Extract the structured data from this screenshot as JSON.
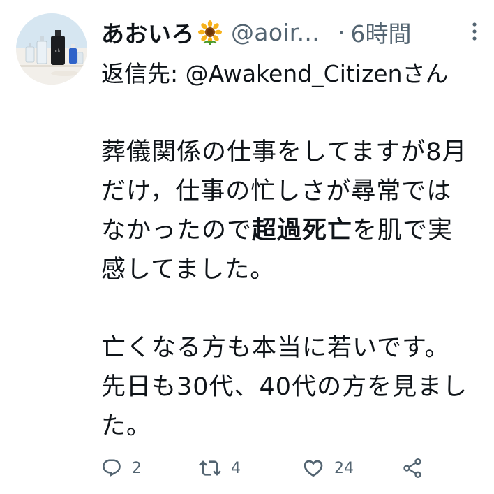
{
  "tweet": {
    "display_name": "あおいろ",
    "handle": "@aoir...",
    "separator": "·",
    "time": "6時間",
    "reply_prefix": "返信先: ",
    "reply_mention": "@Awakend_Citizenさん",
    "text_part1": "葬儀関係の仕事をしてますが8月だけ，仕事の忙しさが尋常ではなかったので",
    "text_bold": "超過死亡",
    "text_part2": "を肌で実感してました。\n\n亡くなる方も本当に若いです。先日も30代、40代の方を見ました。"
  },
  "actions": {
    "reply_count": "2",
    "retweet_count": "4",
    "like_count": "24"
  },
  "icons": {
    "avatar": "perfume-bottles-photo",
    "emoji": "sunflower-emoji",
    "more": "more-vertical-icon",
    "reply": "reply-icon",
    "retweet": "retweet-icon",
    "like": "heart-icon",
    "share": "share-icon"
  },
  "colors": {
    "text": "#0f1419",
    "secondary": "#536471",
    "icon": "#536471"
  }
}
